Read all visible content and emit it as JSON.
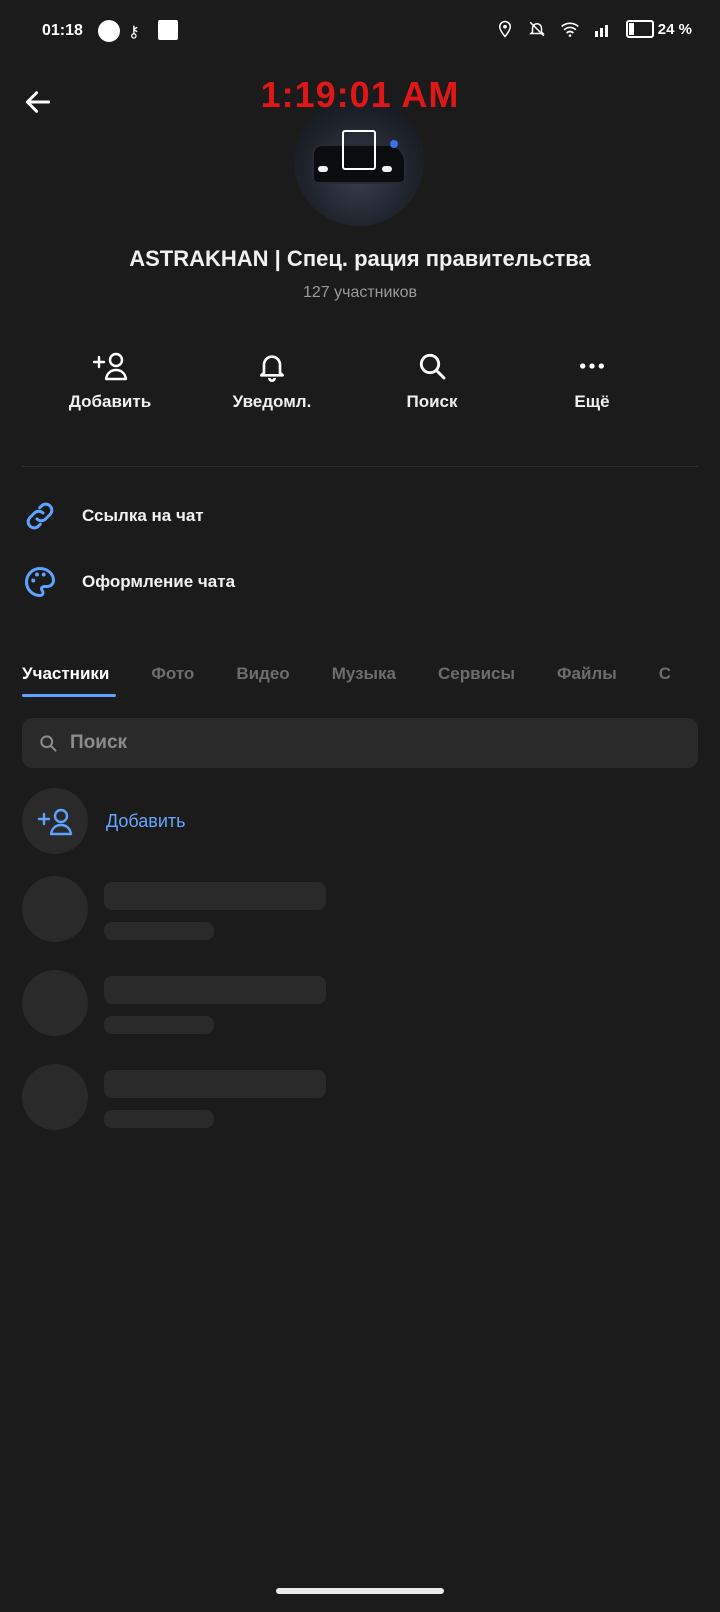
{
  "status_bar": {
    "time": "01:18",
    "battery": "24 %",
    "battery_level": 0.24
  },
  "overlay": {
    "time": "1:19:01 AM"
  },
  "chat": {
    "title": "ASTRAKHAN | Спец. рация правительства",
    "members": "127 участников"
  },
  "actions": [
    {
      "label": "Добавить",
      "icon": "add-person-icon"
    },
    {
      "label": "Уведомл.",
      "icon": "bell-icon"
    },
    {
      "label": "Поиск",
      "icon": "search-icon"
    },
    {
      "label": "Ещё",
      "icon": "more-icon"
    }
  ],
  "links": [
    {
      "label": "Ссылка на чат",
      "icon": "link-icon"
    },
    {
      "label": "Оформление чата",
      "icon": "palette-icon"
    }
  ],
  "tabs": [
    "Участники",
    "Фото",
    "Видео",
    "Музыка",
    "Сервисы",
    "Файлы",
    "С"
  ],
  "search": {
    "placeholder": "Поиск"
  },
  "members_list": {
    "add_label": "Добавить"
  },
  "colors": {
    "background": "#1b1b1b",
    "accent": "#5fa3ff",
    "overlay_time": "#e01717"
  }
}
